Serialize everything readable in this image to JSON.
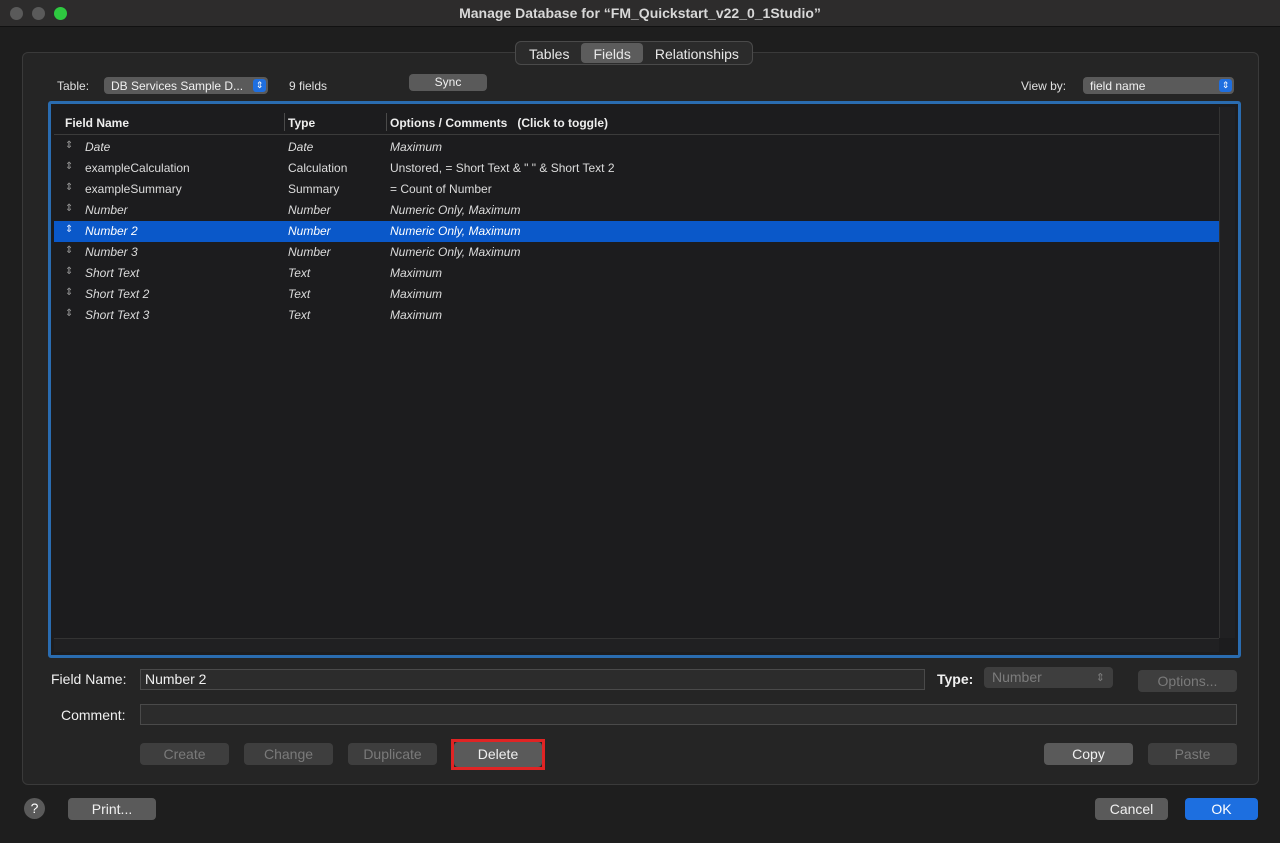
{
  "window": {
    "title": "Manage Database for “FM_Quickstart_v22_0_1Studio”"
  },
  "tabs": [
    {
      "label": "Tables"
    },
    {
      "label": "Fields"
    },
    {
      "label": "Relationships"
    }
  ],
  "toolbar": {
    "table_label": "Table:",
    "table_value": "DB Services Sample D...",
    "field_count": "9 fields",
    "sync_label": "Sync",
    "viewby_label": "View by:",
    "viewby_value": "field name"
  },
  "table": {
    "columns": [
      "Field Name",
      "Type",
      "Options / Comments   (Click to toggle)"
    ],
    "rows": [
      {
        "name": "Date",
        "type": "Date",
        "options": "Maximum"
      },
      {
        "name": "exampleCalculation",
        "type": "Calculation",
        "options": "Unstored, = Short Text & \" \" & Short Text 2"
      },
      {
        "name": "exampleSummary",
        "type": "Summary",
        "options": "= Count of Number"
      },
      {
        "name": "Number",
        "type": "Number",
        "options": "Numeric Only, Maximum"
      },
      {
        "name": "Number 2",
        "type": "Number",
        "options": "Numeric Only, Maximum"
      },
      {
        "name": "Number 3",
        "type": "Number",
        "options": "Numeric Only, Maximum"
      },
      {
        "name": "Short Text",
        "type": "Text",
        "options": "Maximum"
      },
      {
        "name": "Short Text 2",
        "type": "Text",
        "options": "Maximum"
      },
      {
        "name": "Short Text 3",
        "type": "Text",
        "options": "Maximum"
      }
    ]
  },
  "form": {
    "field_name_label": "Field Name:",
    "field_name_value": "Number 2",
    "type_label": "Type:",
    "type_value": "Number",
    "options_label": "Options...",
    "comment_label": "Comment:",
    "comment_value": ""
  },
  "actions": {
    "create": "Create",
    "change": "Change",
    "duplicate": "Duplicate",
    "delete": "Delete",
    "copy": "Copy",
    "paste": "Paste"
  },
  "footer": {
    "help": "?",
    "print": "Print...",
    "cancel": "Cancel",
    "ok": "OK"
  },
  "colors": {
    "accent": "#1d6fe0",
    "selection": "#0a58c9",
    "highlight": "#e02424"
  }
}
